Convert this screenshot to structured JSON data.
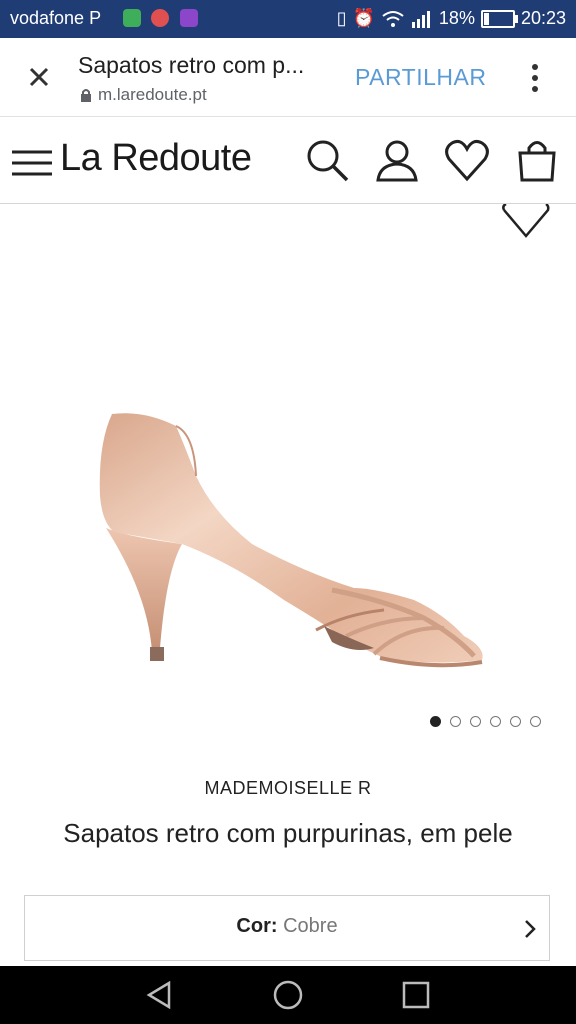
{
  "status_bar": {
    "carrier": "vodafone P",
    "battery": "18%",
    "battery_level": 0.18,
    "time": "20:23"
  },
  "tab": {
    "title": "Sapatos retro com p...",
    "url": "m.laredoute.pt",
    "share_label": "PARTILHAR"
  },
  "site": {
    "logo": "La Redoute",
    "icons": [
      "menu-icon",
      "search-icon",
      "account-icon",
      "wishlist-icon",
      "bag-icon"
    ]
  },
  "product": {
    "image_count": 6,
    "active_image": 1,
    "brand": "MADEMOISELLE R",
    "title": "Sapatos retro com purpurinas, em pele",
    "color_label": "Cor:",
    "color_value": "Cobre"
  },
  "colors": {
    "status_bar_bg": "#1f3c75",
    "share_link": "#5b9bd5",
    "shoe_tone": "#e9bfa7"
  }
}
